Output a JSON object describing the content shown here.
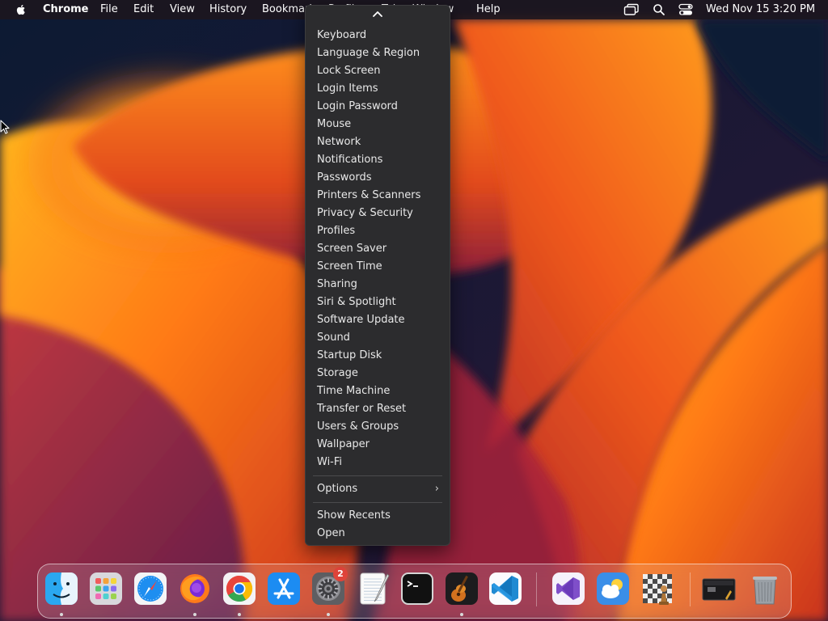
{
  "menubar": {
    "app_name": "Chrome",
    "menus": [
      "File",
      "Edit",
      "View",
      "History",
      "Bookmarks",
      "Profiles",
      "Tab",
      "Window",
      "Help"
    ],
    "clock": "Wed Nov 15  3:20 PM",
    "icons": [
      "apple-icon",
      "screen-mirroring-icon",
      "spotlight-search-icon",
      "control-center-icon"
    ]
  },
  "dropdown": {
    "items": [
      "Keyboard",
      "Language & Region",
      "Lock Screen",
      "Login Items",
      "Login Password",
      "Mouse",
      "Network",
      "Notifications",
      "Passwords",
      "Printers & Scanners",
      "Privacy & Security",
      "Profiles",
      "Screen Saver",
      "Screen Time",
      "Sharing",
      "Siri & Spotlight",
      "Software Update",
      "Sound",
      "Startup Disk",
      "Storage",
      "Time Machine",
      "Transfer or Reset",
      "Users & Groups",
      "Wallpaper",
      "Wi-Fi"
    ],
    "options_label": "Options",
    "options_chevron": "›",
    "bottom_items": [
      "Show Recents",
      "Open"
    ]
  },
  "dock": {
    "apps": [
      {
        "name": "finder",
        "icon": "finder-icon",
        "running": true
      },
      {
        "name": "launchpad",
        "icon": "launchpad-icon",
        "running": false
      },
      {
        "name": "safari",
        "icon": "safari-icon",
        "running": false
      },
      {
        "name": "firefox",
        "icon": "firefox-icon",
        "running": true
      },
      {
        "name": "chrome",
        "icon": "chrome-icon",
        "running": true
      },
      {
        "name": "app-store",
        "icon": "app-store-icon",
        "running": false
      },
      {
        "name": "system-settings",
        "icon": "system-settings-icon",
        "running": true,
        "badge": "2"
      },
      {
        "name": "textedit",
        "icon": "textedit-icon",
        "running": false
      },
      {
        "name": "terminal",
        "icon": "terminal-icon",
        "running": false
      },
      {
        "name": "garageband",
        "icon": "garageband-icon",
        "running": true
      },
      {
        "name": "vscode",
        "icon": "vscode-icon",
        "running": false
      },
      {
        "name": "visual-studio",
        "icon": "visual-studio-icon",
        "running": false
      },
      {
        "name": "weather",
        "icon": "weather-icon",
        "running": false
      },
      {
        "name": "chess",
        "icon": "chess-icon",
        "running": false
      },
      {
        "name": "recent-folder",
        "icon": "folder-stack-icon",
        "running": false
      },
      {
        "name": "trash",
        "icon": "trash-icon",
        "running": false
      }
    ]
  },
  "colors": {
    "menubar_bg": "#1c161e",
    "dropdown_bg": "#2c2c2e",
    "badge": "#e0443b",
    "wallpaper_orange": "#ff8a1a",
    "wallpaper_red": "#d9381e",
    "wallpaper_navy": "#0d1b35"
  }
}
